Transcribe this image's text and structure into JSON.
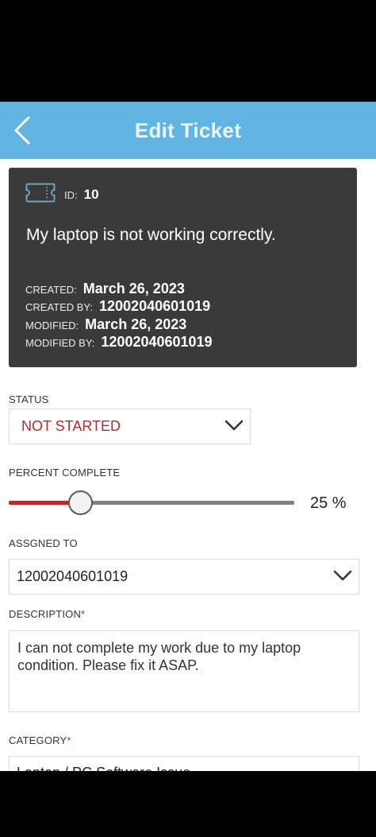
{
  "header": {
    "title": "Edit Ticket"
  },
  "ticket": {
    "id_label": "ID:",
    "id_value": "10",
    "title": "My laptop is not working correctly.",
    "created_label": "CREATED:",
    "created_value": "March 26, 2023",
    "created_by_label": "CREATED BY:",
    "created_by_value": "12002040601019",
    "modified_label": "MODIFIED:",
    "modified_value": "March 26, 2023",
    "modified_by_label": "MODIFIED BY:",
    "modified_by_value": "12002040601019"
  },
  "status": {
    "label": "STATUS",
    "value": "NOT STARTED"
  },
  "percent": {
    "label": "PERCENT COMPLETE",
    "value": 25,
    "display": "25 %"
  },
  "assigned": {
    "label": "ASSGNED TO",
    "value": "12002040601019"
  },
  "description": {
    "label": "DESCRIPTION",
    "required_mark": "*",
    "value": "I can not complete my work due to my laptop condition. Please fix it ASAP."
  },
  "category": {
    "label": "CATEGORY",
    "required_mark": "*",
    "value": "Laptop / PC Software Issue"
  },
  "colors": {
    "header_bg": "#62b4e3",
    "card_bg": "#3a3a3a",
    "accent_red": "#c0272d"
  },
  "icons": {
    "back": "chevron-left-icon",
    "ticket": "ticket-icon",
    "dropdown": "chevron-down-icon"
  }
}
